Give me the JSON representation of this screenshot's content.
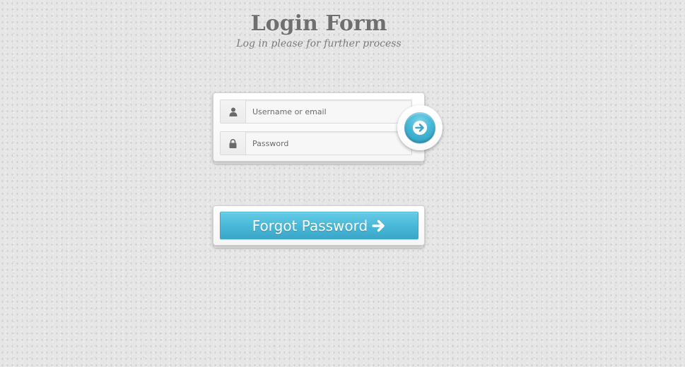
{
  "header": {
    "title": "Login Form",
    "subtitle": "Log in please for further process"
  },
  "login_form": {
    "username": {
      "placeholder": "Username or email",
      "value": "",
      "icon": "user-icon"
    },
    "password": {
      "placeholder": "Password",
      "value": "",
      "icon": "lock-icon"
    },
    "submit": {
      "icon": "arrow-right-icon"
    }
  },
  "forgot": {
    "label": "Forgot Password",
    "icon": "arrow-right-icon"
  },
  "colors": {
    "accent": "#4ab9d9",
    "background": "#e6e6e6",
    "title": "#6f6f6f"
  }
}
